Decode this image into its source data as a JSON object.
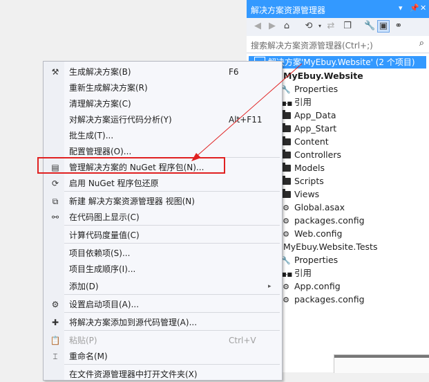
{
  "solution_explorer": {
    "title": "解决方案资源管理器",
    "title_buttons": [
      "▾",
      "📌",
      "✕"
    ],
    "search_placeholder": "搜索解决方案资源管理器(Ctrl+;)",
    "solution_label": "解决方案'MyEbuy.Website' (2 个项目)",
    "tree": [
      {
        "label": "MyEbuy.Website",
        "kind": "project",
        "bold": true
      },
      {
        "label": "Properties",
        "kind": "wrench"
      },
      {
        "label": "引用",
        "kind": "ref"
      },
      {
        "label": "App_Data",
        "kind": "folder"
      },
      {
        "label": "App_Start",
        "kind": "folder"
      },
      {
        "label": "Content",
        "kind": "folder"
      },
      {
        "label": "Controllers",
        "kind": "folder"
      },
      {
        "label": "Models",
        "kind": "folder"
      },
      {
        "label": "Scripts",
        "kind": "folder"
      },
      {
        "label": "Views",
        "kind": "folder"
      },
      {
        "label": "Global.asax",
        "kind": "file"
      },
      {
        "label": "packages.config",
        "kind": "file"
      },
      {
        "label": "Web.config",
        "kind": "file"
      },
      {
        "label": "MyEbuy.Website.Tests",
        "kind": "project",
        "bold": false
      },
      {
        "label": "Properties",
        "kind": "wrench"
      },
      {
        "label": "引用",
        "kind": "ref"
      },
      {
        "label": "App.config",
        "kind": "file"
      },
      {
        "label": "packages.config",
        "kind": "file"
      }
    ]
  },
  "context_menu": {
    "items": [
      {
        "label": "生成解决方案(B)",
        "shortcut": "F6",
        "icon": "build-icon"
      },
      {
        "label": "重新生成解决方案(R)",
        "shortcut": ""
      },
      {
        "label": "清理解决方案(C)",
        "shortcut": ""
      },
      {
        "label": "对解决方案运行代码分析(Y)",
        "shortcut": "Alt+F11"
      },
      {
        "label": "批生成(T)...",
        "shortcut": ""
      },
      {
        "label": "配置管理器(O)...",
        "shortcut": ""
      },
      {
        "label": "管理解决方案的 NuGet 程序包(N)...",
        "shortcut": "",
        "icon": "nuget-package-icon"
      },
      {
        "label": "启用 NuGet 程序包还原",
        "shortcut": "",
        "icon": "restore-icon"
      },
      {
        "label": "新建 解决方案资源管理器 视图(N)",
        "shortcut": "",
        "icon": "new-view-icon"
      },
      {
        "label": "在代码图上显示(C)",
        "shortcut": "",
        "icon": "code-map-icon"
      },
      {
        "label": "计算代码度量值(C)",
        "shortcut": ""
      },
      {
        "label": "项目依赖项(S)...",
        "shortcut": ""
      },
      {
        "label": "项目生成顺序(I)...",
        "shortcut": ""
      },
      {
        "label": "添加(D)",
        "shortcut": "",
        "submenu": "▸"
      },
      {
        "label": "设置启动项目(A)...",
        "shortcut": "",
        "icon": "gear-icon"
      },
      {
        "label": "将解决方案添加到源代码管理(A)...",
        "shortcut": "",
        "icon": "source-control-icon"
      },
      {
        "label": "粘贴(P)",
        "shortcut": "Ctrl+V",
        "icon": "paste-icon",
        "disabled": true
      },
      {
        "label": "重命名(M)",
        "shortcut": "",
        "icon": "rename-icon"
      },
      {
        "label": "在文件资源管理器中打开文件夹(X)",
        "shortcut": ""
      }
    ]
  },
  "colors": {
    "accent": "#3399ff",
    "highlight_box": "#e02020",
    "arrow": "#e02020"
  }
}
